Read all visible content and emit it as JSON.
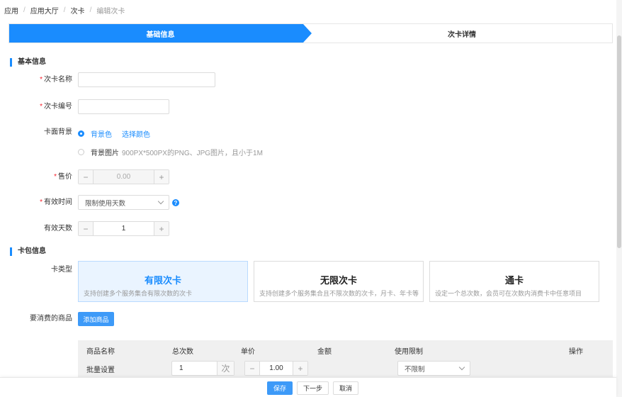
{
  "breadcrumb": [
    "应用",
    "应用大厅",
    "次卡",
    "编辑次卡"
  ],
  "breadcrumb_sep": "/",
  "steps": [
    {
      "label": "基础信息",
      "active": true
    },
    {
      "label": "次卡详情",
      "active": false
    }
  ],
  "basic_section": {
    "title": "基本信息"
  },
  "fields": {
    "card_name": {
      "label": "次卡名称",
      "required": true,
      "value": "",
      "placeholder": ""
    },
    "card_code": {
      "label": "次卡编号",
      "required": true,
      "value": "",
      "placeholder": ""
    },
    "background": {
      "label": "卡面背景",
      "option_color": "背景色",
      "pick_color_link": "选择颜色",
      "option_image": "背景图片",
      "image_hint": "900PX*500PX的PNG、JPG图片，且小于1M",
      "selected": "color"
    },
    "price": {
      "label": "售价",
      "required": true,
      "value": "0.00",
      "minus": "−",
      "plus": "+"
    },
    "valid_time": {
      "label": "有效时间",
      "required": true,
      "value": "限制使用天数",
      "help": "?"
    },
    "valid_days": {
      "label": "有效天数",
      "value": "1",
      "minus": "−",
      "plus": "+"
    }
  },
  "package_section": {
    "title": "卡包信息"
  },
  "card_type": {
    "label": "卡类型",
    "options": [
      {
        "title": "有限次卡",
        "desc": "支持创建多个服务集合有限次数的次卡",
        "selected": true
      },
      {
        "title": "无限次卡",
        "desc": "支持创建多个服务集合且不限次数的次卡，月卡、年卡等",
        "selected": false
      },
      {
        "title": "通卡",
        "desc": "设定一个总次数，会员可在次数内消费卡中任意项目",
        "selected": false
      }
    ]
  },
  "goods": {
    "label": "要消费的商品",
    "add_button": "添加商品"
  },
  "table": {
    "headers": [
      "商品名称",
      "总次数",
      "单价",
      "金额",
      "使用限制",
      "操作"
    ],
    "batch": {
      "label": "批量设置",
      "total_value": "1",
      "total_unit": "次",
      "price_value": "1.00",
      "minus": "−",
      "plus": "+",
      "limit_value": "不限制"
    }
  },
  "footer": {
    "save": "保存",
    "next": "下一步",
    "cancel": "取消"
  },
  "colors": {
    "accent": "#1a8cfe",
    "required": "#f5222d"
  }
}
